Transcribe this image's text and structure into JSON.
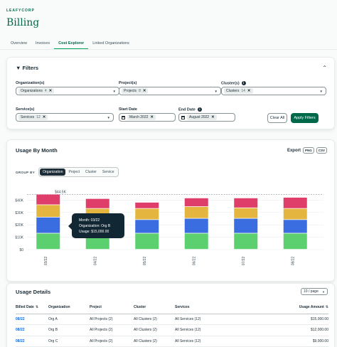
{
  "brand": "LEAFYCORP",
  "page_title": "Billing",
  "tabs": [
    {
      "label": "Overview",
      "active": false
    },
    {
      "label": "Invoices",
      "active": false
    },
    {
      "label": "Cost Explorer",
      "active": true
    },
    {
      "label": "Linked Organizations",
      "active": false
    }
  ],
  "filters": {
    "title": "Filters",
    "organizations": {
      "label": "Organization(s)",
      "chip": "Organizations",
      "count": "4"
    },
    "projects": {
      "label": "Project(s)",
      "chip": "Projects",
      "count": "8"
    },
    "clusters": {
      "label": "Cluster(s)",
      "chip": "Clusters",
      "count": "14"
    },
    "services": {
      "label": "Service(s)",
      "chip": "Services",
      "count": "12"
    },
    "start_date": {
      "label": "Start Date",
      "value": "March 2022"
    },
    "end_date": {
      "label": "End Date",
      "value": "August 2022"
    },
    "clear_label": "Clear All",
    "apply_label": "Apply Filters"
  },
  "usage": {
    "title": "Usage By Month",
    "export_label": "Export",
    "export_png": "PNG",
    "export_csv": "CSV",
    "group_by_label": "GROUP BY",
    "group_options": [
      {
        "label": "Organization",
        "active": true
      },
      {
        "label": "Project",
        "active": false
      },
      {
        "label": "Cluster",
        "active": false
      },
      {
        "label": "Service",
        "active": false
      }
    ],
    "tooltip": {
      "line1": "Month: 03/22",
      "line2": "Organization: Org B",
      "line3": "Usage: $15,000.00"
    }
  },
  "chart_data": {
    "type": "bar",
    "stacked": true,
    "categories": [
      "03/22",
      "04/22",
      "05/22",
      "06/22",
      "07/22",
      "08/22"
    ],
    "series": [
      {
        "color": "#5ccf6e",
        "values": [
          13000,
          13000,
          13000,
          13000,
          13000,
          13000
        ]
      },
      {
        "color": "#3a6de0",
        "values": [
          13000,
          11000,
          11000,
          12000,
          12000,
          11000
        ]
      },
      {
        "color": "#e5b63f",
        "values": [
          10000,
          9000,
          9000,
          9500,
          8500,
          9000
        ]
      },
      {
        "color": "#df3e6a",
        "values": [
          8500,
          8000,
          5000,
          7000,
          8000,
          9000
        ]
      }
    ],
    "reference_line": {
      "value": 44500,
      "label": "$44.5K"
    },
    "yticks": [
      "$0",
      "$10K",
      "$20K",
      "$30K",
      "$40K"
    ],
    "ylim": [
      0,
      50000
    ],
    "grid": true
  },
  "details": {
    "title": "Usage Details",
    "per_page": "10 / page",
    "columns": [
      "Billed Date",
      "Organization",
      "Project",
      "Cluster",
      "Services",
      "Usage Amount"
    ],
    "rows": [
      [
        "08/22",
        "Org A",
        "All Projects (2)",
        "All Clusters (2)",
        "All Services (12)",
        "$15,000.00"
      ],
      [
        "08/22",
        "Org B",
        "All Projects (2)",
        "All Clusters (2)",
        "All Services (12)",
        "$12,000.00"
      ],
      [
        "08/22",
        "Org C",
        "All Projects (2)",
        "All Clusters (2)",
        "All Services (12)",
        "$9,000.00"
      ]
    ]
  }
}
